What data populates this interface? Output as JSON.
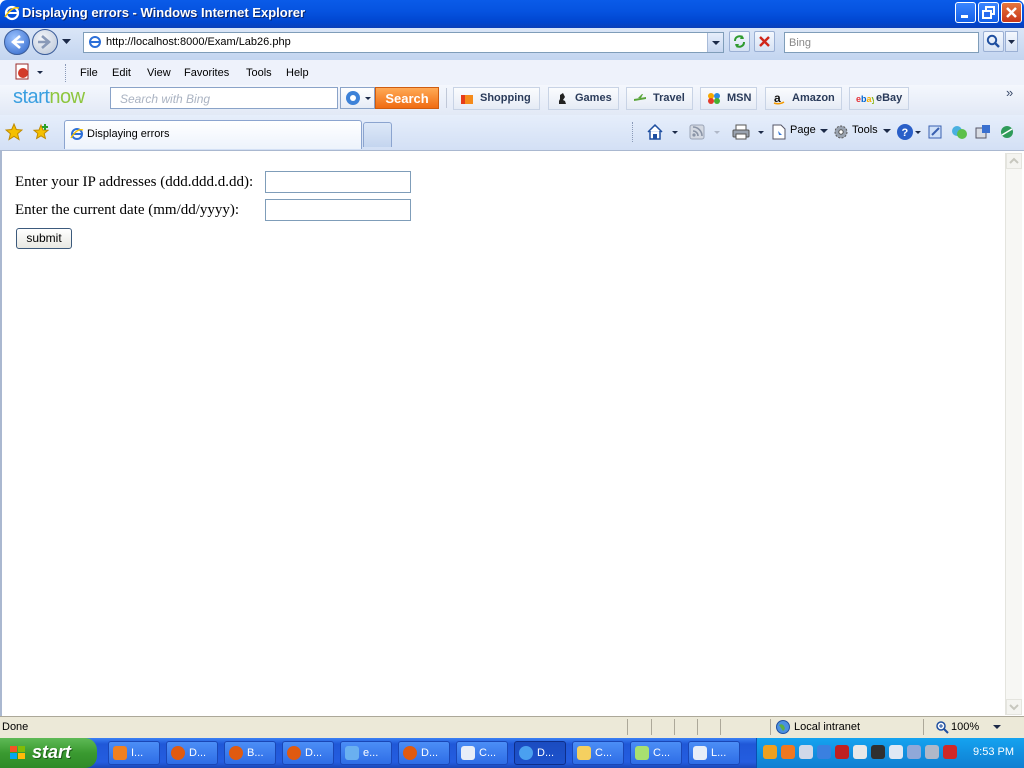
{
  "window": {
    "title": "Displaying errors - Windows Internet Explorer"
  },
  "nav": {
    "address": "http://localhost:8000/Exam/Lab26.php",
    "search_placeholder": "Bing"
  },
  "menu": [
    "File",
    "Edit",
    "View",
    "Favorites",
    "Tools",
    "Help"
  ],
  "startnow": {
    "logo_a": "start",
    "logo_b": "now",
    "search_placeholder": "Search with Bing",
    "search_button": "Search",
    "links": [
      "Shopping",
      "Games",
      "Travel",
      "MSN",
      "Amazon",
      "eBay"
    ]
  },
  "tabs": {
    "active_title": "Displaying errors"
  },
  "commandbar": {
    "page": "Page",
    "tools": "Tools"
  },
  "form": {
    "ip_label": "Enter your IP addresses (ddd.ddd.d.dd):",
    "ip_value": "",
    "date_label": "Enter the current date (mm/dd/yyyy):",
    "date_value": "",
    "submit_label": "submit"
  },
  "status": {
    "text": "Done",
    "zone": "Local intranet",
    "zoom": "100%"
  },
  "taskbar": {
    "start": "start",
    "buttons": [
      "I...",
      "D...",
      "B...",
      "D...",
      "e...",
      "D...",
      "C...",
      "D...",
      "C...",
      "C...",
      "L..."
    ],
    "clock": "9:53 PM"
  },
  "colors": {
    "xp_blue": "#0653e0",
    "start_green": "#3a9a30",
    "search_orange": "#f06b12",
    "tray_blue": "#1290e0"
  }
}
